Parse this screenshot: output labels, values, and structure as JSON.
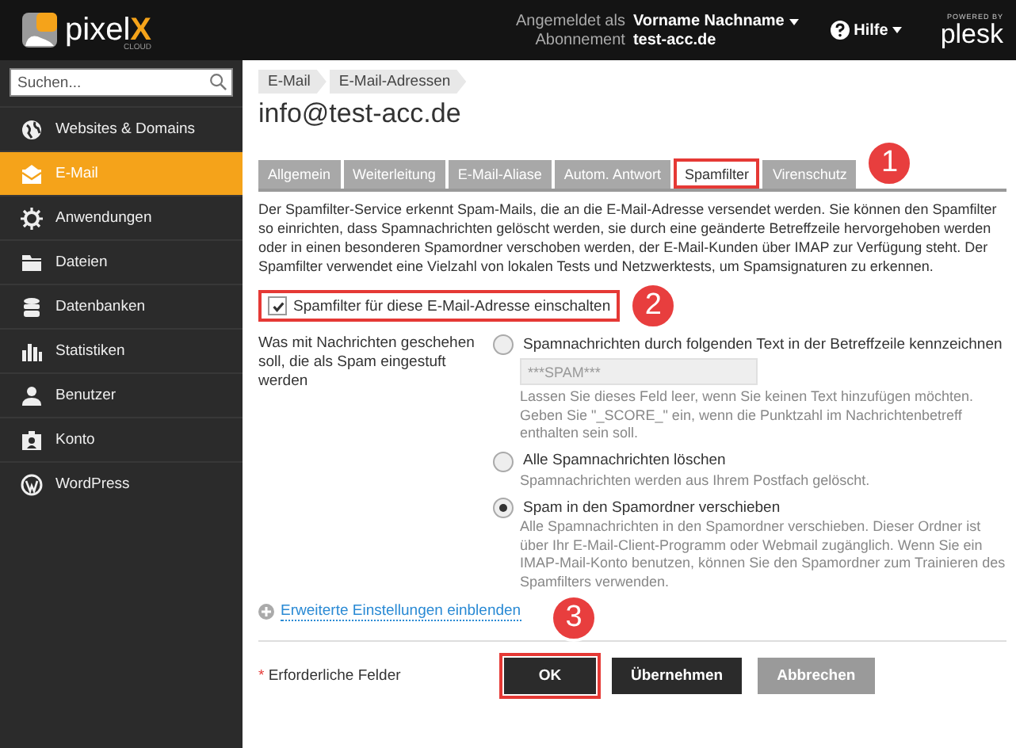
{
  "header": {
    "logo": {
      "text": "pixel",
      "accent": "X",
      "sub": "CLOUD"
    },
    "user_label": "Angemeldet als",
    "user_name": "Vorname Nachname",
    "subscription_label": "Abonnement",
    "subscription": "test-acc.de",
    "help": "Hilfe",
    "powered_by": "POWERED BY",
    "brand": "plesk"
  },
  "sidebar": {
    "search": {
      "placeholder": "Suchen..."
    },
    "items": [
      {
        "label": "Websites & Domains",
        "kind": "globe",
        "selected": false
      },
      {
        "label": "E-Mail",
        "kind": "mail",
        "selected": true
      },
      {
        "label": "Anwendungen",
        "kind": "gear",
        "selected": false
      },
      {
        "label": "Dateien",
        "kind": "folder",
        "selected": false
      },
      {
        "label": "Datenbanken",
        "kind": "database",
        "selected": false
      },
      {
        "label": "Statistiken",
        "kind": "stats",
        "selected": false
      },
      {
        "label": "Benutzer",
        "kind": "user",
        "selected": false
      },
      {
        "label": "Konto",
        "kind": "account",
        "selected": false
      },
      {
        "label": "WordPress",
        "kind": "wordpress",
        "selected": false
      }
    ]
  },
  "breadcrumbs": [
    "E-Mail",
    "E-Mail-Adressen"
  ],
  "title": "info@test-acc.de",
  "tabs": [
    {
      "label": "Allgemein",
      "selected": false
    },
    {
      "label": "Weiterleitung",
      "selected": false
    },
    {
      "label": "E-Mail-Aliase",
      "selected": false
    },
    {
      "label": "Autom. Antwort",
      "selected": false
    },
    {
      "label": "Spamfilter",
      "selected": true
    },
    {
      "label": "Virenschutz",
      "selected": false
    }
  ],
  "intro": "Der Spamfilter-Service erkennt Spam-Mails, die an die E-Mail-Adresse versendet werden. Sie können den Spamfilter so einrichten, dass Spamnachrichten gelöscht werden, sie durch eine geänderte Betreffzeile hervorgehoben werden oder in einen besonderen Spamordner verschoben werden, der E-Mail-Kunden über IMAP zur Verfügung steht. Der Spamfilter verwendet eine Vielzahl von lokalen Tests und Netzwerktests, um Spamsignaturen zu erkennen.",
  "enable_checkbox": {
    "label": "Spamfilter für diese E-Mail-Adresse einschalten",
    "checked": true
  },
  "spam_action": {
    "label": "Was mit Nachrichten geschehen soll, die als Spam eingestuft werden",
    "options": [
      {
        "label": "Spamnachrichten durch folgenden Text in der Betreffzeile kennzeichnen",
        "selected": false,
        "field": {
          "value": "***SPAM***"
        },
        "description": "Lassen Sie dieses Feld leer, wenn Sie keinen Text hinzufügen möchten. Geben Sie \"_SCORE_\" ein, wenn die Punktzahl im Nachrichtenbetreff enthalten sein soll."
      },
      {
        "label": "Alle Spamnachrichten löschen",
        "selected": false,
        "description": "Spamnachrichten werden aus Ihrem Postfach gelöscht."
      },
      {
        "label": "Spam in den Spamordner verschieben",
        "selected": true,
        "description": "Alle Spamnachrichten in den Spamordner verschieben. Dieser Ordner ist über Ihr E-Mail-Client-Programm oder Webmail zugänglich. Wenn Sie ein IMAP-Mail-Konto benutzen, können Sie den Spamordner zum Trainieren des Spamfilters verwenden."
      }
    ]
  },
  "advanced_link": "Erweiterte Einstellungen einblenden",
  "required_note": {
    "mark": "*",
    "text": "Erforderliche Felder"
  },
  "buttons": [
    {
      "label": "OK",
      "kind": "primary",
      "highlighted": true
    },
    {
      "label": "Übernehmen",
      "kind": "primary",
      "highlighted": false
    },
    {
      "label": "Abbrechen",
      "kind": "cancel",
      "highlighted": false
    }
  ],
  "annotations": [
    "1",
    "2",
    "3"
  ]
}
